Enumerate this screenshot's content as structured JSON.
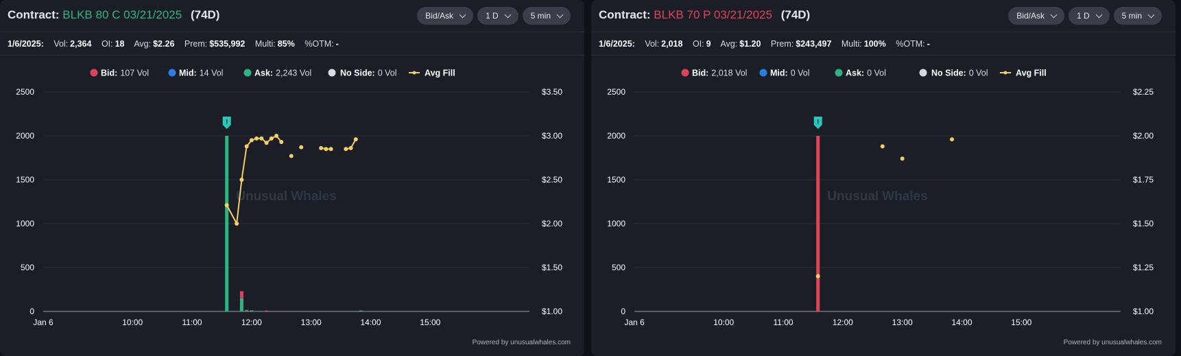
{
  "panels": [
    {
      "contract_label": "Contract:",
      "contract_name": "BLKB 80 C 03/21/2025",
      "days": "(74D)",
      "name_color": "#2fb37f",
      "dropdowns": [
        "Bid/Ask",
        "1 D",
        "5 min"
      ],
      "stats": {
        "date": "1/6/2025:",
        "vol_label": "Vol:",
        "vol": "2,364",
        "oi_label": "OI:",
        "oi": "18",
        "avg_label": "Avg:",
        "avg": "$2.26",
        "prem_label": "Prem:",
        "prem": "$535,992",
        "multi_label": "Multi:",
        "multi": "85%",
        "otm_label": "%OTM:",
        "otm": "-"
      },
      "powered_by": "Powered by unusualwhales.com",
      "watermark": [
        "Unusual",
        "Whales"
      ],
      "chart_data": {
        "type": "bar",
        "legend": [
          {
            "label": "Bid:",
            "value": "107 Vol",
            "color": "#e04358"
          },
          {
            "label": "Mid:",
            "value": "14 Vol",
            "color": "#2a7de1"
          },
          {
            "label": "Ask:",
            "value": "2,243 Vol",
            "color": "#2fb37f"
          },
          {
            "label": "No Side:",
            "value": "0 Vol",
            "color": "#d9dadd"
          },
          {
            "label": "Avg Fill",
            "value": "",
            "color": "#f5cf66",
            "line": true
          }
        ],
        "y_left_ticks": [
          "2500",
          "2000",
          "1500",
          "1000",
          "500",
          "0"
        ],
        "y_left_lim": [
          0,
          2500
        ],
        "y_right_ticks": [
          "$3.50",
          "$3.00",
          "$2.50",
          "$2.00",
          "$1.50",
          "$1.00"
        ],
        "y_right_lim": [
          1.0,
          3.5
        ],
        "x_ticks": [
          "Jan 6",
          "10:00",
          "11:00",
          "12:00",
          "13:00",
          "14:00",
          "15:00"
        ],
        "x_tick_minutes": [
          510,
          600,
          660,
          720,
          780,
          840,
          900
        ],
        "x_lim": [
          510,
          1000
        ],
        "marker_minute": 695,
        "bars": [
          {
            "minute": 695,
            "ask": 2000,
            "bid": 0
          },
          {
            "minute": 710,
            "ask": 150,
            "bid": 80
          },
          {
            "minute": 715,
            "ask": 10,
            "bid": 8
          },
          {
            "minute": 720,
            "ask": 12,
            "bid": 0
          },
          {
            "minute": 735,
            "ask": 0,
            "bid": 10
          },
          {
            "minute": 830,
            "ask": 10,
            "bid": 0
          }
        ],
        "avg_fill": [
          {
            "minute": 695,
            "price": 2.21,
            "connect": false
          },
          {
            "minute": 705,
            "price": 2.0,
            "connect": true
          },
          {
            "minute": 710,
            "price": 2.5,
            "connect": true
          },
          {
            "minute": 715,
            "price": 2.88,
            "connect": true
          },
          {
            "minute": 720,
            "price": 2.95,
            "connect": true
          },
          {
            "minute": 725,
            "price": 2.97,
            "connect": true
          },
          {
            "minute": 730,
            "price": 2.97,
            "connect": true
          },
          {
            "minute": 735,
            "price": 2.92,
            "connect": true
          },
          {
            "minute": 740,
            "price": 2.97,
            "connect": true
          },
          {
            "minute": 745,
            "price": 3.0,
            "connect": true
          },
          {
            "minute": 750,
            "price": 2.93,
            "connect": true
          },
          {
            "minute": 760,
            "price": 2.77,
            "connect": false
          },
          {
            "minute": 770,
            "price": 2.87,
            "connect": false
          },
          {
            "minute": 790,
            "price": 2.86,
            "connect": false
          },
          {
            "minute": 795,
            "price": 2.85,
            "connect": true
          },
          {
            "minute": 800,
            "price": 2.85,
            "connect": true
          },
          {
            "minute": 815,
            "price": 2.85,
            "connect": false
          },
          {
            "minute": 820,
            "price": 2.86,
            "connect": true
          },
          {
            "minute": 825,
            "price": 2.96,
            "connect": true
          }
        ]
      }
    },
    {
      "contract_label": "Contract:",
      "contract_name": "BLKB 70 P 03/21/2025",
      "days": "(74D)",
      "name_color": "#e04358",
      "dropdowns": [
        "Bid/Ask",
        "1 D",
        "5 min"
      ],
      "stats": {
        "date": "1/6/2025:",
        "vol_label": "Vol:",
        "vol": "2,018",
        "oi_label": "OI:",
        "oi": "9",
        "avg_label": "Avg:",
        "avg": "$1.20",
        "prem_label": "Prem:",
        "prem": "$243,497",
        "multi_label": "Multi:",
        "multi": "100%",
        "otm_label": "%OTM:",
        "otm": "-"
      },
      "powered_by": "Powered by unusualwhales.com",
      "watermark": [
        "Unusual",
        "Whales"
      ],
      "chart_data": {
        "type": "bar",
        "legend": [
          {
            "label": "Bid:",
            "value": "2,018 Vol",
            "color": "#e04358"
          },
          {
            "label": "Mid:",
            "value": "0 Vol",
            "color": "#2a7de1"
          },
          {
            "label": "Ask:",
            "value": "0 Vol",
            "color": "#2fb37f"
          },
          {
            "label": "No Side:",
            "value": "0 Vol",
            "color": "#d9dadd"
          },
          {
            "label": "Avg Fill",
            "value": "",
            "color": "#f5cf66",
            "line": true
          }
        ],
        "y_left_ticks": [
          "2500",
          "2000",
          "1500",
          "1000",
          "500",
          "0"
        ],
        "y_left_lim": [
          0,
          2500
        ],
        "y_right_ticks": [
          "$2.25",
          "$2.00",
          "$1.75",
          "$1.50",
          "$1.25",
          "$1.00"
        ],
        "y_right_lim": [
          1.0,
          2.25
        ],
        "x_ticks": [
          "Jan 6",
          "10:00",
          "11:00",
          "12:00",
          "13:00",
          "14:00",
          "15:00"
        ],
        "x_tick_minutes": [
          510,
          600,
          660,
          720,
          780,
          840,
          900
        ],
        "x_lim": [
          510,
          1000
        ],
        "marker_minute": 695,
        "bars": [
          {
            "minute": 695,
            "ask": 0,
            "bid": 2000
          }
        ],
        "avg_fill": [
          {
            "minute": 695,
            "price": 1.2,
            "connect": false
          },
          {
            "minute": 760,
            "price": 1.94,
            "connect": false
          },
          {
            "minute": 780,
            "price": 1.87,
            "connect": false
          },
          {
            "minute": 830,
            "price": 1.98,
            "connect": false
          }
        ]
      }
    }
  ]
}
